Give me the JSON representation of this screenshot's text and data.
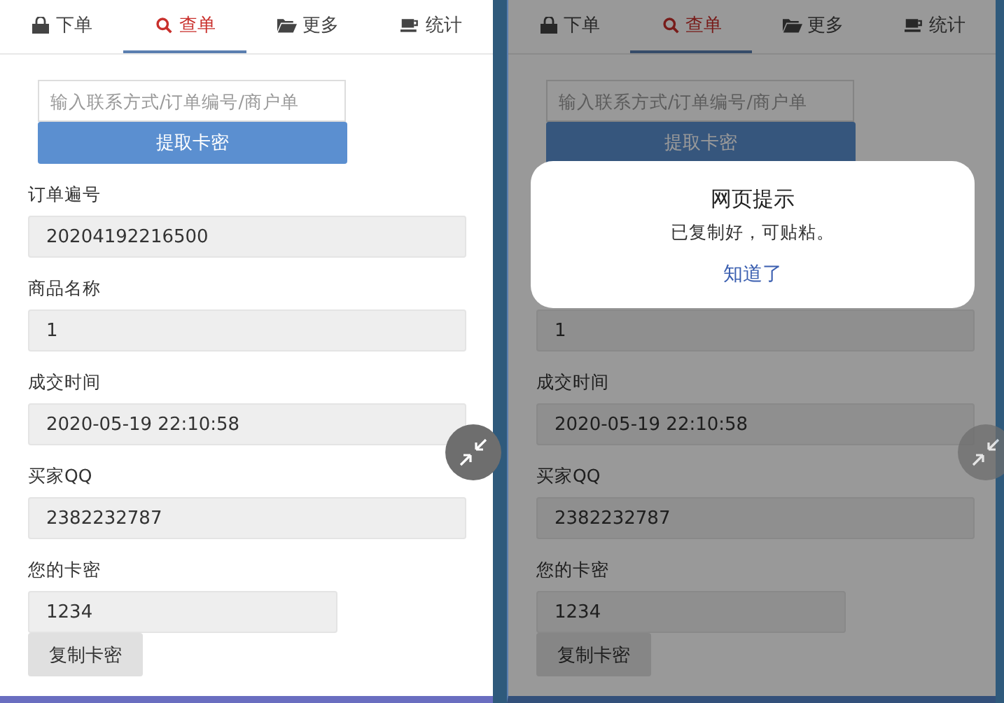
{
  "screens": [
    {
      "dimmed": false,
      "tabs": [
        {
          "label": "下单",
          "selected": false
        },
        {
          "label": "查单",
          "selected": true
        },
        {
          "label": "更多",
          "selected": false
        },
        {
          "label": "统计",
          "selected": false
        }
      ],
      "search": {
        "placeholder": "输入联系方式/订单编号/商户单"
      },
      "submit_button": "提取卡密",
      "fields": [
        {
          "kind": "wide",
          "label": "订单遍号",
          "value": "20204192216500"
        },
        {
          "kind": "wide",
          "label": "商品名称",
          "value": "1"
        },
        {
          "kind": "wide",
          "label": "成交时间",
          "value": "2020-05-19 22:10:58"
        },
        {
          "kind": "wide",
          "label": "买家QQ",
          "value": "2382232787"
        },
        {
          "kind": "short",
          "label": "您的卡密",
          "value": "1234"
        }
      ],
      "copy_button": "复制卡密"
    },
    {
      "dimmed": true,
      "tabs": [
        {
          "label": "下单",
          "selected": false
        },
        {
          "label": "查单",
          "selected": true
        },
        {
          "label": "更多",
          "selected": false
        },
        {
          "label": "统计",
          "selected": false
        }
      ],
      "search": {
        "placeholder": "输入联系方式/订单编号/商户单"
      },
      "submit_button": "提取卡密",
      "fields": [
        {
          "kind": "wide",
          "value": "1"
        },
        {
          "kind": "wide",
          "label": "成交时间",
          "value": "2020-05-19 22:10:58"
        },
        {
          "kind": "wide",
          "label": "买家QQ",
          "value": "2382232787"
        },
        {
          "kind": "short",
          "label": "您的卡密",
          "value": "1234"
        }
      ],
      "copy_button": "复制卡密",
      "dialog": {
        "title": "网页提示",
        "message": "已复制好，可贴粘。",
        "button": "知道了"
      }
    }
  ]
}
